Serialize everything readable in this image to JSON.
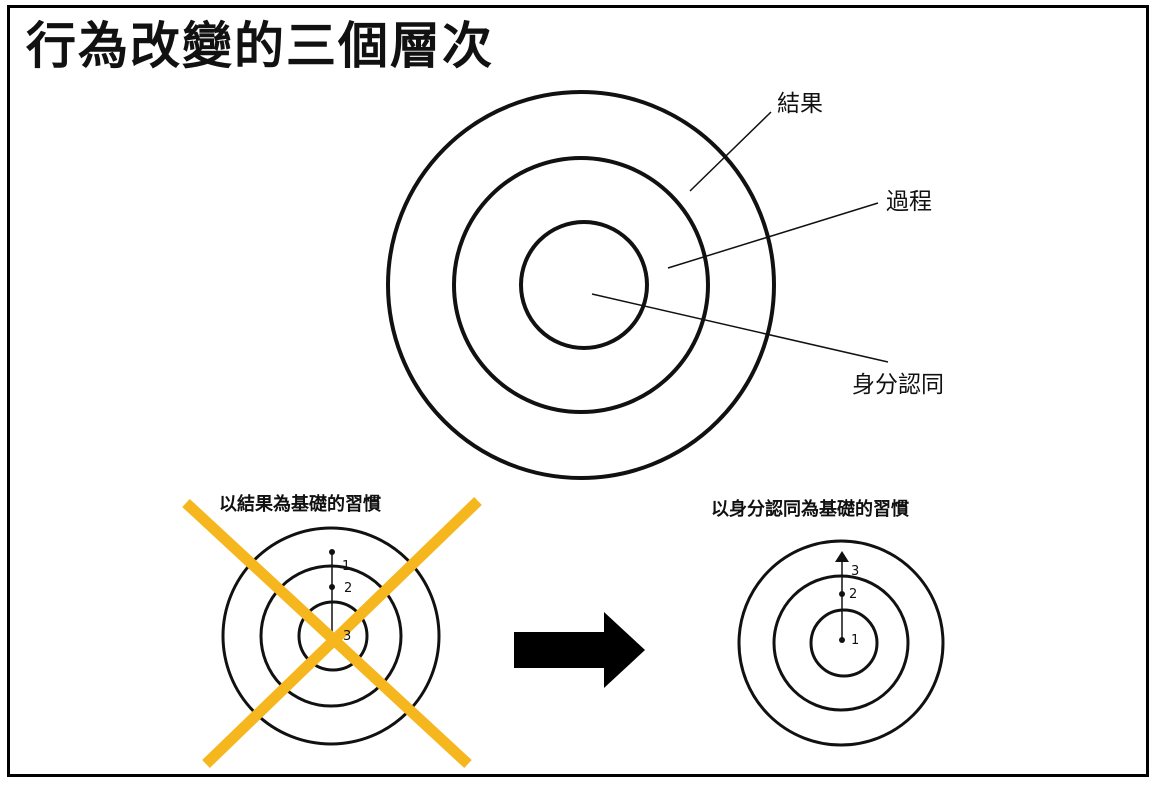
{
  "title": "行為改變的三個層次",
  "main_diagram": {
    "labels": {
      "outer": "結果",
      "middle": "過程",
      "inner": "身分認同"
    }
  },
  "left_diagram": {
    "caption": "以結果為基礎的習慣",
    "steps": [
      "1",
      "2",
      "3"
    ],
    "rejected": true
  },
  "right_diagram": {
    "caption": "以身分認同為基礎的習慣",
    "steps": [
      "1",
      "2",
      "3"
    ]
  },
  "colors": {
    "cross": "#f5b61e",
    "stroke": "#111111"
  },
  "icons": [
    "arrow-right-icon",
    "cross-out-icon"
  ]
}
